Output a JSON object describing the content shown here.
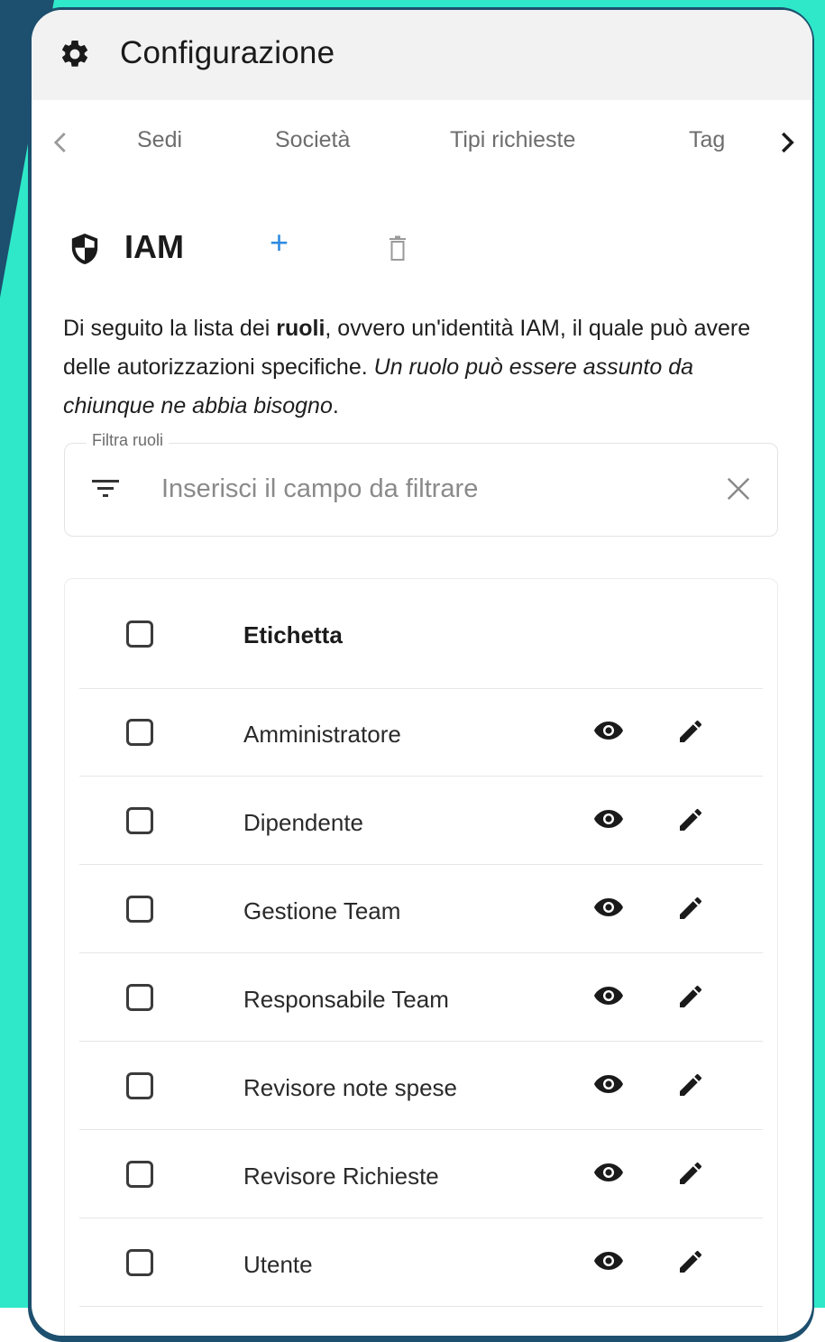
{
  "appbar": {
    "title": "Configurazione"
  },
  "tabs": [
    {
      "label": "Sedi"
    },
    {
      "label": "Società"
    },
    {
      "label": "Tipi richieste"
    },
    {
      "label": "Tag"
    }
  ],
  "section": {
    "title": "IAM",
    "add_label": "+"
  },
  "description": {
    "part1": "Di seguito la lista dei ",
    "bold": "ruoli",
    "part2": ", ovvero un'identità IAM, il quale può avere delle autorizzazioni specifiche. ",
    "italic": "Un ruolo può essere assunto da chiunque ne abbia bisogno",
    "end": "."
  },
  "filter": {
    "label": "Filtra ruoli",
    "placeholder": "Inserisci il campo da filtrare",
    "value": ""
  },
  "table": {
    "header": "Etichetta",
    "rows": [
      {
        "label": "Amministratore"
      },
      {
        "label": "Dipendente"
      },
      {
        "label": "Gestione Team"
      },
      {
        "label": "Responsabile Team"
      },
      {
        "label": "Revisore note spese"
      },
      {
        "label": "Revisore Richieste"
      },
      {
        "label": "Utente"
      }
    ]
  },
  "colors": {
    "background_teal": "#2ee8c9",
    "frame_navy": "#1d4f6e",
    "accent_blue": "#2f8be0",
    "appbar_bg": "#f2f2f2"
  },
  "icons": {
    "appbar": "gear-icon",
    "tab_prev": "chevron-left-icon",
    "tab_next": "chevron-right-icon",
    "section": "shield-icon",
    "add": "plus-icon",
    "delete": "trash-icon",
    "filter": "filter-icon",
    "clear": "close-icon",
    "view": "eye-icon",
    "edit": "pencil-icon"
  }
}
